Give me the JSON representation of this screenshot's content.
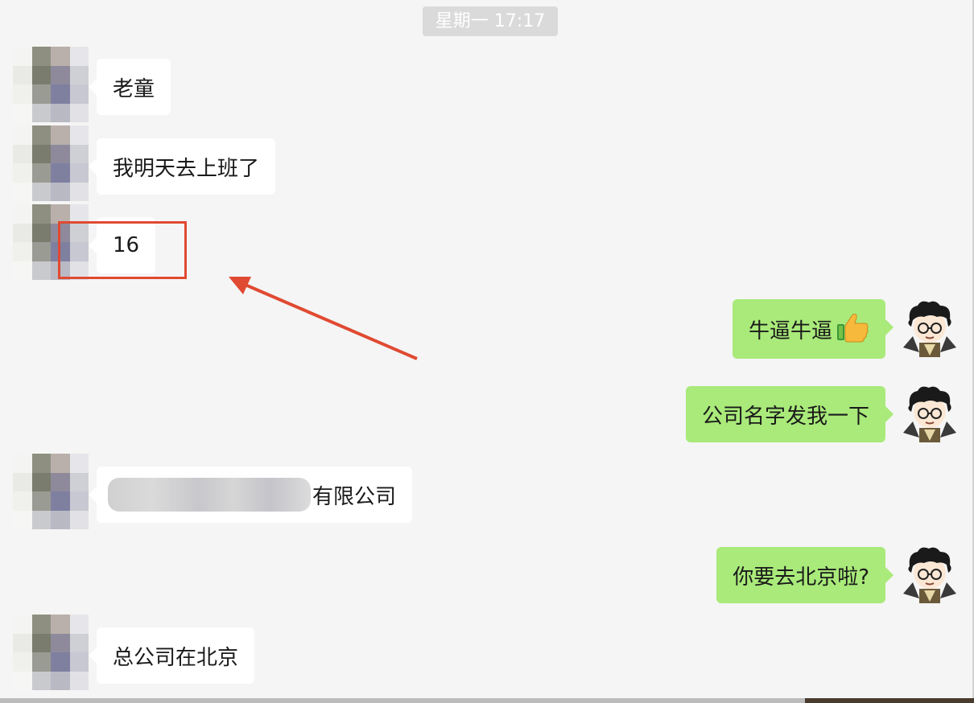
{
  "conversation": {
    "timestamp": "星期一 17:17",
    "messages": [
      {
        "side": "left",
        "text": "老童"
      },
      {
        "side": "left",
        "text": "我明天去上班了"
      },
      {
        "side": "left",
        "text": "16"
      },
      {
        "side": "right",
        "text": "牛逼牛逼",
        "emoji": "thumbs-up-icon"
      },
      {
        "side": "right",
        "text": "公司名字发我一下"
      },
      {
        "side": "left",
        "text": "有限公司",
        "redacted_prefix": true
      },
      {
        "side": "right",
        "text": "你要去北京啦?"
      },
      {
        "side": "left",
        "text": "总公司在北京"
      }
    ]
  },
  "annotation": {
    "box_color": "#e04a32",
    "arrow_color": "#e04a32"
  },
  "colors": {
    "incoming_bubble": "#ffffff",
    "outgoing_bubble": "#a9ea7a",
    "background": "#f5f5f5",
    "timestamp_bg": "#dadada"
  }
}
